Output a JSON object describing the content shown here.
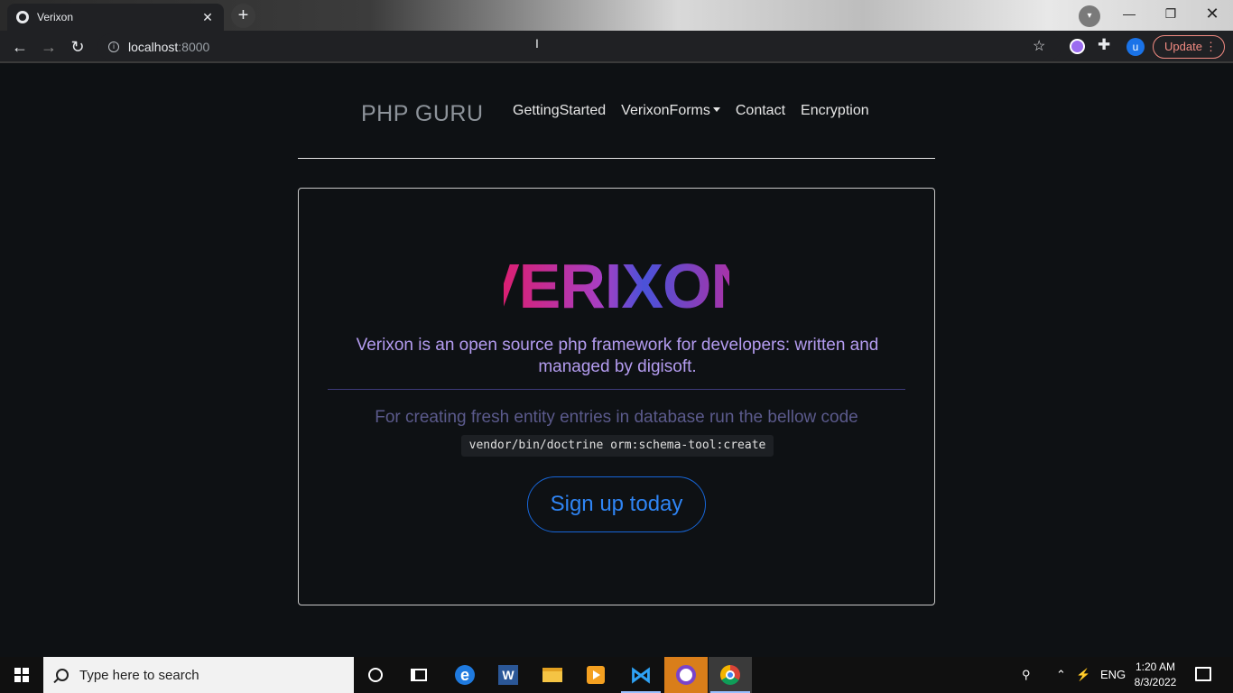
{
  "browser": {
    "tab_title": "Verixon",
    "tab_close": "✕",
    "new_tab": "+",
    "url_host": "localhost",
    "url_port": ":8000",
    "update_label": "Update",
    "profile_initial": "u"
  },
  "navbar": {
    "brand": "PHP GURU",
    "links": [
      "GettingStarted",
      "VerixonForms",
      "Contact",
      "Encryption"
    ]
  },
  "hero": {
    "logo_text": "VERIXON",
    "lead": "Verixon is an open source php framework for developers: written and managed by digisoft.",
    "muted": "For creating fresh entity entries in database run the bellow code",
    "code": "vendor/bin/doctrine orm:schema-tool:create",
    "cta": "Sign up today"
  },
  "taskbar": {
    "search_placeholder": "Type here to search",
    "lang": "ENG",
    "time": "1:20 AM",
    "date": "8/3/2022"
  },
  "colors": {
    "page_bg": "#0e1114",
    "lead_text": "#b49cf0",
    "cta_blue": "#2f85f5",
    "logo_pink": "#e8175d",
    "logo_purple": "#7a3fc9"
  }
}
